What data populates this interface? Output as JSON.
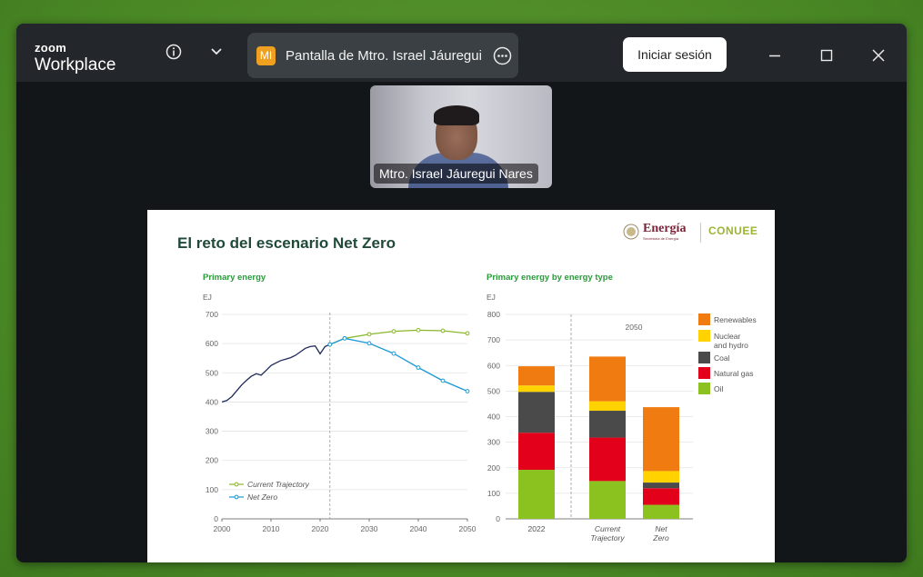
{
  "app": {
    "brand_small": "zoom",
    "brand_big": "Workplace",
    "share_avatar_initials": "MI",
    "share_title": "Pantalla de Mtro. Israel Jáuregui N",
    "signin_label": "Iniciar sesión"
  },
  "icons": {
    "info": "info-icon",
    "chevron": "chevron-down-icon",
    "more": "more-options-icon",
    "minimize": "minimize-icon",
    "maximize": "maximize-icon",
    "close": "close-icon"
  },
  "colors": {
    "accent_orange": "#f0a020",
    "title_green": "#1f4a3a",
    "chart_label_green": "#2a9a3a"
  },
  "participant": {
    "name": "Mtro. Israel Jáuregui Nares"
  },
  "slide": {
    "title": "El reto del escenario Net Zero",
    "brand_energia": "Energía",
    "brand_energia_sub": "Secretaría de Energía",
    "brand_conuee": "CONUEE"
  },
  "chart_data": [
    {
      "type": "line",
      "title": "Primary energy",
      "ylabel": "EJ",
      "xlim": [
        2000,
        2050
      ],
      "ylim": [
        0,
        700
      ],
      "xticks": [
        2000,
        2010,
        2020,
        2030,
        2040,
        2050
      ],
      "yticks": [
        0,
        100,
        200,
        300,
        400,
        500,
        600,
        700
      ],
      "divider_x": 2022,
      "history": {
        "x": [
          2000,
          2001,
          2002,
          2003,
          2004,
          2005,
          2006,
          2007,
          2008,
          2009,
          2010,
          2011,
          2012,
          2013,
          2014,
          2015,
          2016,
          2017,
          2018,
          2019,
          2020,
          2021,
          2022
        ],
        "y": [
          400,
          405,
          418,
          438,
          458,
          474,
          488,
          497,
          492,
          508,
          525,
          534,
          542,
          547,
          552,
          560,
          572,
          584,
          590,
          592,
          565,
          590,
          597
        ]
      },
      "series": [
        {
          "name": "Current Trajectory",
          "color": "#8ab82a",
          "x": [
            2022,
            2025,
            2030,
            2035,
            2040,
            2045,
            2050
          ],
          "y": [
            597,
            618,
            632,
            642,
            646,
            644,
            635
          ]
        },
        {
          "name": "Net Zero",
          "color": "#1b9ad6",
          "x": [
            2022,
            2025,
            2030,
            2035,
            2040,
            2045,
            2050
          ],
          "y": [
            597,
            618,
            601,
            566,
            518,
            473,
            437
          ]
        }
      ],
      "legend": "bottom-left"
    },
    {
      "type": "bar",
      "title": "Primary energy by energy type",
      "ylabel": "EJ",
      "ylim": [
        0,
        800
      ],
      "yticks": [
        0,
        100,
        200,
        300,
        400,
        500,
        600,
        700,
        800
      ],
      "annotation": "2050",
      "categories": [
        "2022",
        "Current Trajectory",
        "Net Zero"
      ],
      "series": [
        {
          "name": "Oil",
          "color": "#8cc21f",
          "values": [
            192,
            148,
            55
          ]
        },
        {
          "name": "Natural gas",
          "color": "#e3001b",
          "values": [
            145,
            170,
            65
          ]
        },
        {
          "name": "Coal",
          "color": "#4a4a4a",
          "values": [
            160,
            105,
            22
          ]
        },
        {
          "name": "Nuclear and hydro",
          "color": "#ffd200",
          "values": [
            25,
            37,
            45
          ]
        },
        {
          "name": "Renewables",
          "color": "#f07c11",
          "values": [
            75,
            175,
            250
          ]
        }
      ],
      "legend": "right"
    }
  ]
}
